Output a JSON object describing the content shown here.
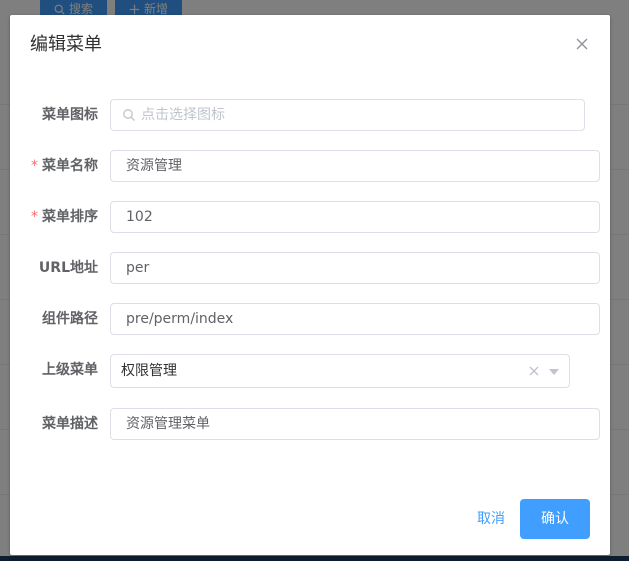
{
  "background": {
    "search_button_label": "搜索",
    "add_button_label": "新增"
  },
  "dialog": {
    "title": "编辑菜单",
    "fields": {
      "icon": {
        "label": "菜单图标",
        "value": "",
        "placeholder": "点击选择图标",
        "icon": "search-icon"
      },
      "name": {
        "label": "菜单名称",
        "value": "资源管理",
        "required": true
      },
      "sort": {
        "label": "菜单排序",
        "value": "102",
        "required": true
      },
      "url": {
        "label": "URL地址",
        "value": "per"
      },
      "component": {
        "label": "组件路径",
        "value": "pre/perm/index"
      },
      "parent": {
        "label": "上级菜单",
        "value": "权限管理"
      },
      "description": {
        "label": "菜单描述",
        "value": "资源管理菜单"
      }
    },
    "required_mark": "*",
    "cancel_label": "取消",
    "confirm_label": "确认"
  },
  "colors": {
    "primary": "#409eff",
    "required": "#f56c6c",
    "overlay": "rgba(0,0,0,0.5)"
  }
}
